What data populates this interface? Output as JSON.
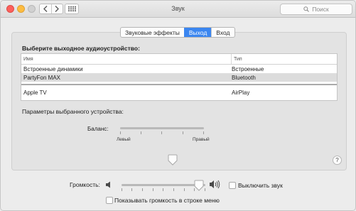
{
  "window": {
    "title": "Звук",
    "search_placeholder": "Поиск"
  },
  "tabs": [
    {
      "label": "Звуковые эффекты",
      "active": false
    },
    {
      "label": "Выход",
      "active": true
    },
    {
      "label": "Вход",
      "active": false
    }
  ],
  "output": {
    "heading": "Выберите выходное аудиоустройство:",
    "columns": [
      "Имя",
      "Тип"
    ],
    "devices": [
      {
        "name": "Встроенные динамики",
        "type": "Встроенные",
        "selected": false
      },
      {
        "name": "PartyFon MAX",
        "type": "Bluetooth",
        "selected": true
      },
      {
        "name": "Apple TV",
        "type": "AirPlay",
        "selected": false
      }
    ]
  },
  "settings": {
    "heading": "Параметры выбранного устройства:",
    "balance_label": "Баланс:",
    "balance_left": "Левый",
    "balance_right": "Правый",
    "balance_value": 0.5
  },
  "volume": {
    "label": "Громкость:",
    "level": 0.92,
    "mute_label": "Выключить звук",
    "mute_checked": false,
    "show_in_menu_label": "Показывать громкость в строке меню",
    "show_in_menu_checked": false
  },
  "icons": {
    "back": "chevron-left-icon",
    "forward": "chevron-right-icon",
    "grid": "grid-icon",
    "search": "search-icon",
    "help": "help-icon",
    "speaker_low": "speaker-low-icon",
    "speaker_high": "speaker-high-icon"
  },
  "colors": {
    "accent": "#3b86f0",
    "close": "#fc605c",
    "minimize": "#fdbc40",
    "zoom": "#d0d0d0"
  }
}
